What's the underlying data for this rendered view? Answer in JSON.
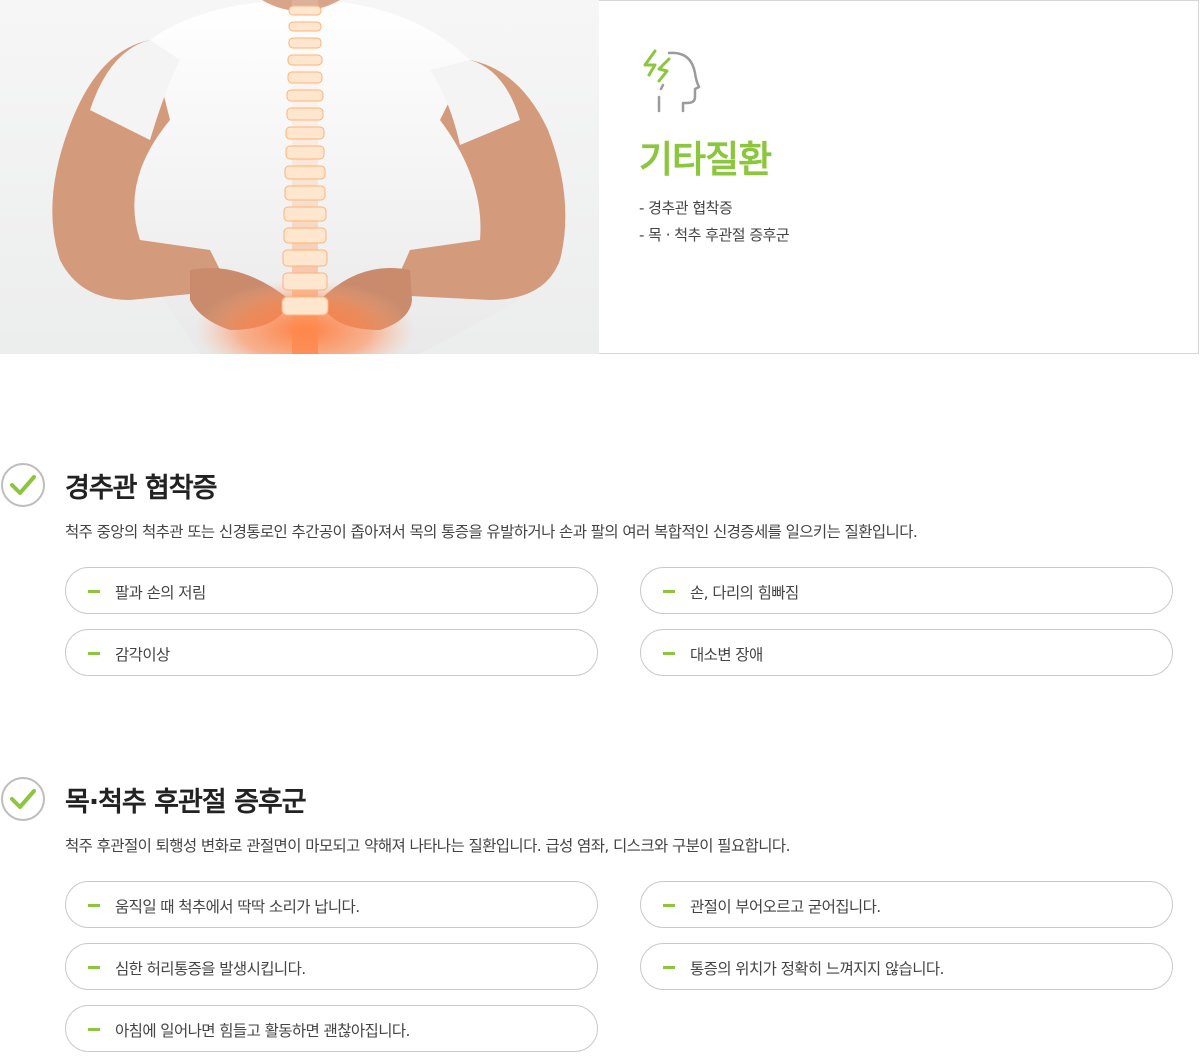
{
  "hero": {
    "title": "기타질환",
    "items": [
      "- 경추관 협착증",
      "- 목 · 척추 후관절 증후군"
    ],
    "icon": "head-lightning-icon",
    "accent_color": "#8cc63e"
  },
  "sections": [
    {
      "title": "경추관 협착증",
      "description": "척주 중앙의 척추관 또는 신경통로인 추간공이 좁아져서 목의 통증을 유발하거나 손과 팔의 여러 복합적인 신경증세를 일으키는 질환입니다.",
      "symptoms": [
        "팔과 손의 저림",
        "손, 다리의 힘빠짐",
        "감각이상",
        "대소변 장애"
      ]
    },
    {
      "title": "목·척추 후관절 증후군",
      "description": "척주 후관절이 퇴행성 변화로 관절면이 마모되고 약해져 나타나는 질환입니다. 급성 염좌, 디스크와 구분이 필요합니다.",
      "symptoms": [
        "움직일 때 척추에서 딱딱 소리가 납니다.",
        "관절이 부어오르고 굳어집니다.",
        "심한 허리통증을 발생시킵니다.",
        "통증의 위치가 정확히 느껴지지 않습니다.",
        "아침에 일어나면 힘들고 활동하면 괜찮아집니다."
      ]
    }
  ]
}
